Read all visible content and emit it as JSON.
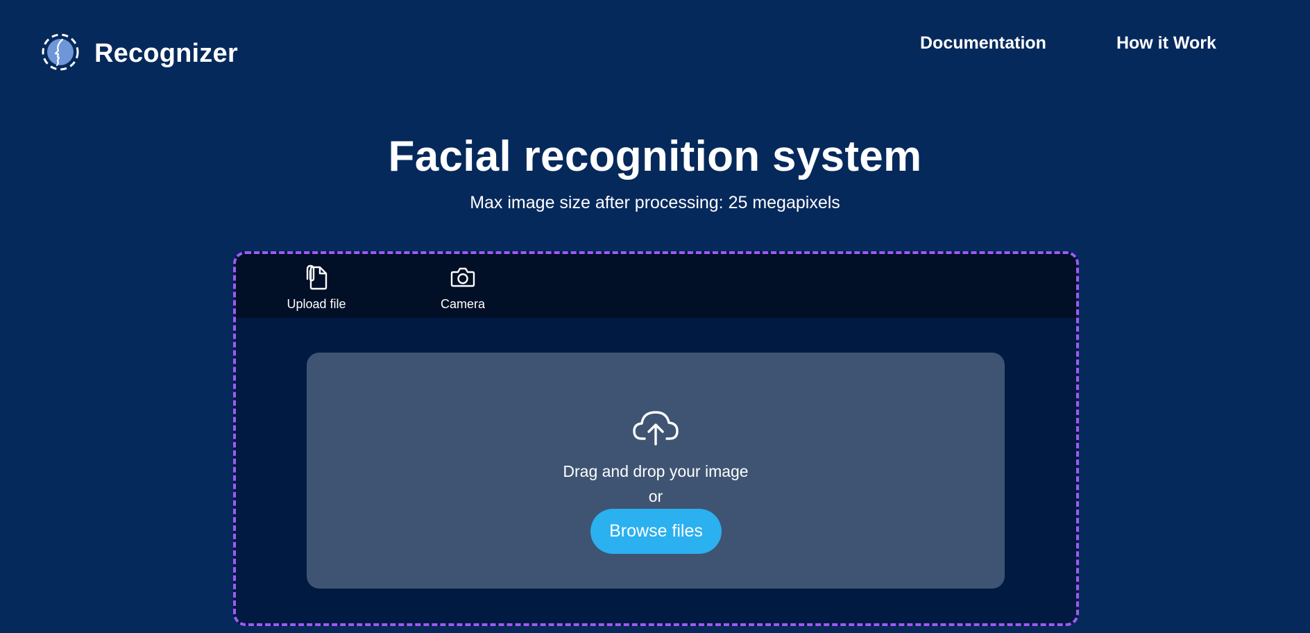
{
  "header": {
    "brand_name": "Recognizer",
    "logo_icon": "face-profile-icon",
    "nav": [
      {
        "label": "Documentation"
      },
      {
        "label": "How it Work"
      }
    ]
  },
  "hero": {
    "title": "Facial recognition system",
    "subtitle": "Max image size after processing: 25 megapixels"
  },
  "uploader": {
    "tabs": [
      {
        "label": "Upload file",
        "icon": "file-upload-icon"
      },
      {
        "label": "Camera",
        "icon": "camera-icon"
      }
    ],
    "dropzone": {
      "icon": "cloud-upload-icon",
      "drag_text": "Drag and drop your image",
      "or_text": "or",
      "browse_label": "Browse files"
    }
  },
  "colors": {
    "background": "#06295c",
    "panel_border": "#a259f4",
    "panel_background": "#011a42",
    "tabbar_background": "#010f27",
    "dropzone_background": "#3e5472",
    "browse_button": "#2bb0f0"
  }
}
